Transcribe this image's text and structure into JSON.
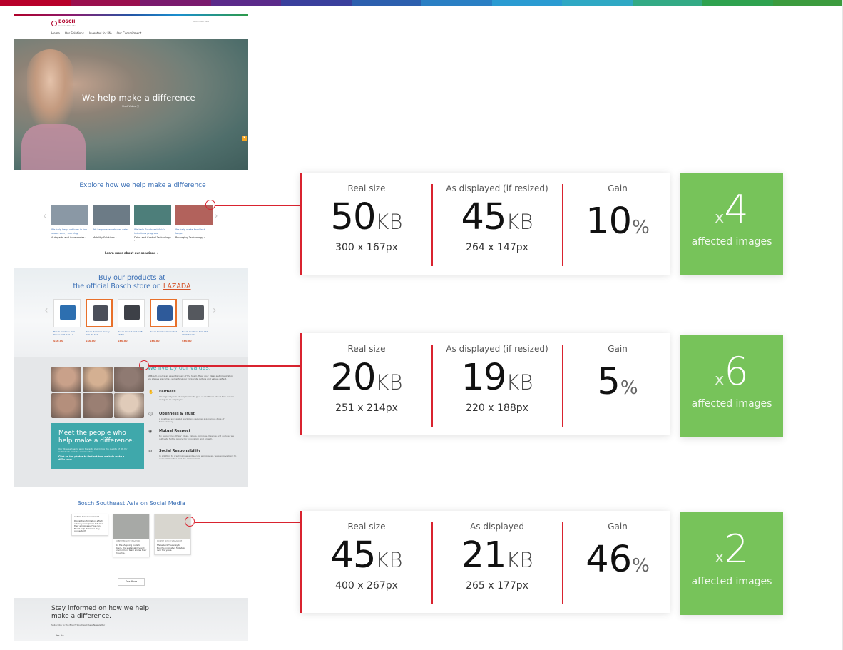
{
  "colors": {
    "accent_red": "#d9232f",
    "green_box": "#77c35a",
    "bosch_blue": "#3a6fb5",
    "teal": "#3fa8ab",
    "top_bar": [
      "#b8002a",
      "#9a0f4e",
      "#7a1a6e",
      "#5b2a8a",
      "#3a3f9c",
      "#2c5fae",
      "#2a7fc4",
      "#2a9bd2",
      "#2fa8c4",
      "#33aa85",
      "#2fa24f",
      "#3c9b3e"
    ]
  },
  "site": {
    "logo": "BOSCH",
    "logo_sub": "Invented for life",
    "util": "Southeast Asia",
    "nav": [
      "Home",
      "Our Solutions",
      "Invented for life",
      "Our Commitment"
    ],
    "hero": {
      "title": "We help make a difference",
      "cta": "Start Video ⓘ"
    },
    "explore": {
      "title": "Explore how we help make a difference",
      "tiles": [
        {
          "caption": "We help keep vehicles in top shape every morning",
          "link": "Autoparts and Accessories  ›",
          "img_color": "#8a98a5"
        },
        {
          "caption": "We help make vehicles safer",
          "link": "Mobility Solutions  ›",
          "img_color": "#6c7b86"
        },
        {
          "caption": "We help Southeast Asia's industries progress",
          "link": "Drive and Control Technology  ›",
          "img_color": "#4d7e7a"
        },
        {
          "caption": "We help make food last longer",
          "link": "Packaging Technology  ›",
          "img_color": "#b2625c"
        }
      ],
      "learn_more": "Learn more about our solutions  ›"
    },
    "buy": {
      "title_line1": "Buy our products at",
      "title_line2_prefix": "the official Bosch store on",
      "lazada": "LAZADA",
      "products": [
        {
          "caption": "Bosch Cordless Drill Driver GSR 120-LI",
          "price": "S$0.00",
          "obj_color": "#2d6fb0"
        },
        {
          "caption": "Bosch Hammer Rotary Drill Bit Set",
          "price": "S$0.00",
          "obj_color": "#4b4f5a"
        },
        {
          "caption": "Bosch Impact Drill GSB 16 RE",
          "price": "S$0.00",
          "obj_color": "#3d4047"
        },
        {
          "caption": "Bosch Safety Glasses Set",
          "price": "S$0.00",
          "obj_color": "#2e5a9a"
        },
        {
          "caption": "Bosch Cordless Drill GSR 1000 Smart",
          "price": "S$0.00",
          "obj_color": "#55585e"
        }
      ]
    },
    "values": {
      "title": "We live by our values.",
      "intro": "At Bosch, you're an essential part of the team. Hear your ideas and imagination are always welcome - something our corporate culture and values reflect.",
      "items": [
        {
          "icon": "✋",
          "name": "Fairness",
          "text": "We regularly ask all employees to give us feedback about how we are doing as an employer."
        },
        {
          "icon": "☺",
          "name": "Openness & Trust",
          "text": "A positive, successful workplace requires a generous dose of transparency."
        },
        {
          "icon": "◉",
          "name": "Mutual Respect",
          "text": "By respecting others' ideas, values, opinions, lifestyle and culture, we cultivate fertile ground for innovation and growth."
        },
        {
          "icon": "⚙",
          "name": "Social Responsibility",
          "text": "In addition to creating new and secure workplaces, we also give back to our communities and the environment."
        }
      ],
      "meet": {
        "title": "Meet the people who help make a difference.",
        "sub": "Our diverse teams work towards improving the quality of life for individuals and the communities.",
        "link": "Click on the photos to find out how we help make a difference."
      },
      "photo_colors": [
        "#c9a18a",
        "#d4b092",
        "#8f7a72",
        "#b48f7c",
        "#9a7f73",
        "#e0cbb9"
      ]
    },
    "social": {
      "title": "Bosch Southeast Asia on Social Media",
      "posts": [
        {
          "header": "ROBERT BOSCH SINGAPORE",
          "text": "Digital transformation affects not only enterprises but also their employees. How can Bosch help its teams stay connected?",
          "img_color": ""
        },
        {
          "header": "ROBERT BOSCH SINGAPORE",
          "text": "On the shopping route to Bosch, the sustainability and environment team shares their thoughts.",
          "img_color": "#a7a9a6"
        },
        {
          "header": "ROBERT BOSCH SINGAPORE",
          "text": "Throwback Thursday to Bosch's innovative footsteps over the years.",
          "img_color": "#d8d6cf"
        }
      ],
      "see_more": "See More"
    },
    "newsletter": {
      "title": "Stay informed on how we help make a difference.",
      "sub": "Subscribe to the Bosch Southeast Asia Newsletter",
      "options": "Yes     No"
    }
  },
  "cards": [
    {
      "real_label": "Real size",
      "real_value": "50",
      "real_unit": "KB",
      "real_dims": "300 x 167px",
      "disp_label": "As displayed  (if resized)",
      "disp_value": "45",
      "disp_unit": "KB",
      "disp_dims": "264 x 147px",
      "gain_label": "Gain",
      "gain_value": "10",
      "gain_unit": "%",
      "mult_x": "x",
      "mult_count": "4",
      "affected": "affected images"
    },
    {
      "real_label": "Real size",
      "real_value": "20",
      "real_unit": "KB",
      "real_dims": "251 x 214px",
      "disp_label": "As displayed (if resized)",
      "disp_value": "19",
      "disp_unit": "KB",
      "disp_dims": "220 x 188px",
      "gain_label": "Gain",
      "gain_value": "5",
      "gain_unit": "%",
      "mult_x": "x",
      "mult_count": "6",
      "affected": "affected images"
    },
    {
      "real_label": "Real size",
      "real_value": "45",
      "real_unit": "KB",
      "real_dims": "400 x 267px",
      "disp_label": "As displayed",
      "disp_value": "21",
      "disp_unit": "KB",
      "disp_dims": "265 x 177px",
      "gain_label": "Gain",
      "gain_value": "46",
      "gain_unit": "%",
      "mult_x": "x",
      "mult_count": "2",
      "affected": "affected images"
    }
  ]
}
